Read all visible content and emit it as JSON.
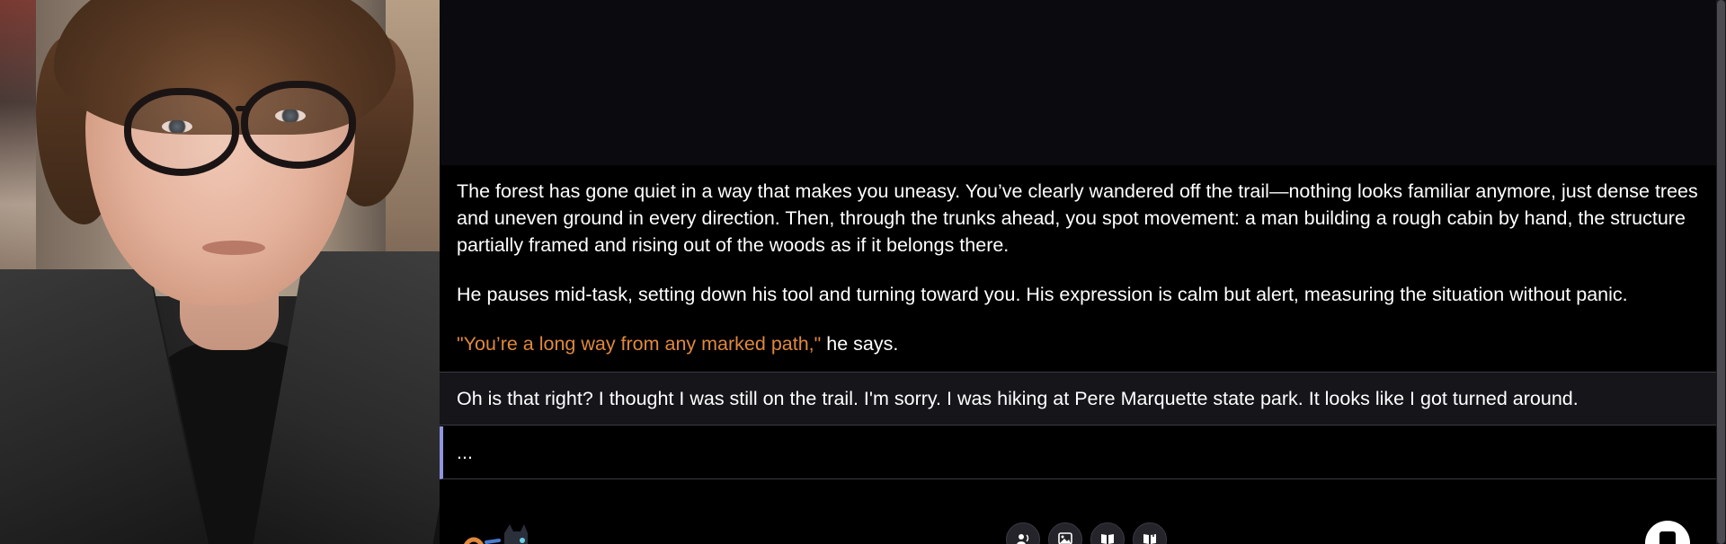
{
  "character": {
    "portrait_alt": "Young man with glasses portrait"
  },
  "messages": {
    "ai_paragraph_1": "The forest has gone quiet in a way that makes you uneasy. You’ve clearly wandered off the trail—nothing looks familiar anymore, just dense trees and uneven ground in every direction. Then, through the trunks ahead, you spot movement: a man building a rough cabin by hand, the structure partially framed and rising out of the woods as if it belongs there.",
    "ai_paragraph_2": "He pauses mid-task, setting down his tool and turning toward you. His expression is calm but alert, measuring the situation without panic.",
    "ai_quote": "\"You’re a long way from any marked path,\"",
    "ai_quote_tail": " he says.",
    "user_message": "Oh is that right? I thought I was still on the trail. I'm sorry. I was hiking at Pere Marquette state park. It looks like I got turned around.",
    "pending": "..."
  },
  "toolbar": {
    "buttons": [
      "voice-icon",
      "image-icon",
      "book-icon",
      "book-audio-icon"
    ]
  },
  "colors": {
    "quote": "#e0883d",
    "accent_border": "#8f95dd",
    "user_bg": "#15151a"
  }
}
